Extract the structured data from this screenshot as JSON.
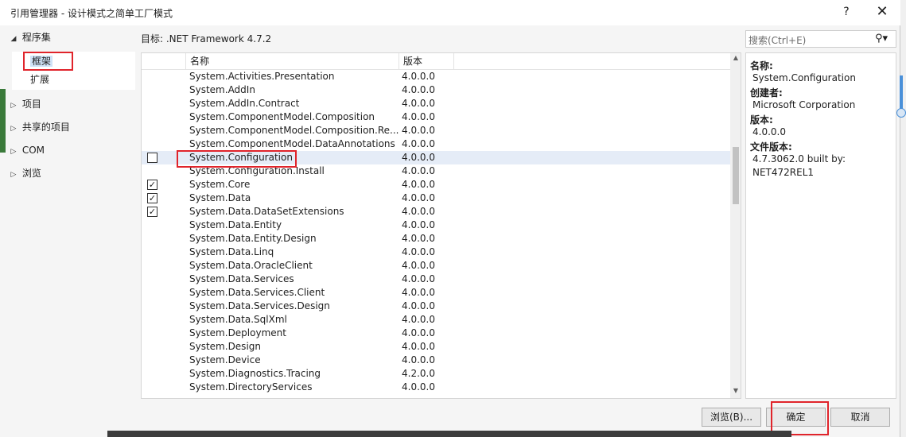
{
  "window": {
    "title": "引用管理器 - 设计模式之简单工厂模式",
    "help_label": "?",
    "close_label": "✕"
  },
  "nav": {
    "assemblies_label": "程序集",
    "framework_label": "框架",
    "extensions_label": "扩展",
    "projects_label": "项目",
    "shared_projects_label": "共享的项目",
    "com_label": "COM",
    "browse_label": "浏览"
  },
  "target_label": "目标: .NET Framework 4.7.2",
  "list": {
    "col_name": "名称",
    "col_version": "版本",
    "rows": [
      {
        "name": "System.Activities.Presentation",
        "version": "4.0.0.0",
        "checkbox": "none",
        "selected": false
      },
      {
        "name": "System.AddIn",
        "version": "4.0.0.0",
        "checkbox": "none",
        "selected": false
      },
      {
        "name": "System.AddIn.Contract",
        "version": "4.0.0.0",
        "checkbox": "none",
        "selected": false
      },
      {
        "name": "System.ComponentModel.Composition",
        "version": "4.0.0.0",
        "checkbox": "none",
        "selected": false
      },
      {
        "name": "System.ComponentModel.Composition.Re...",
        "version": "4.0.0.0",
        "checkbox": "none",
        "selected": false
      },
      {
        "name": "System.ComponentModel.DataAnnotations",
        "version": "4.0.0.0",
        "checkbox": "none",
        "selected": false
      },
      {
        "name": "System.Configuration",
        "version": "4.0.0.0",
        "checkbox": "unchecked",
        "selected": true
      },
      {
        "name": "System.Configuration.Install",
        "version": "4.0.0.0",
        "checkbox": "none",
        "selected": false
      },
      {
        "name": "System.Core",
        "version": "4.0.0.0",
        "checkbox": "checked",
        "selected": false
      },
      {
        "name": "System.Data",
        "version": "4.0.0.0",
        "checkbox": "checked",
        "selected": false
      },
      {
        "name": "System.Data.DataSetExtensions",
        "version": "4.0.0.0",
        "checkbox": "checked",
        "selected": false
      },
      {
        "name": "System.Data.Entity",
        "version": "4.0.0.0",
        "checkbox": "none",
        "selected": false
      },
      {
        "name": "System.Data.Entity.Design",
        "version": "4.0.0.0",
        "checkbox": "none",
        "selected": false
      },
      {
        "name": "System.Data.Linq",
        "version": "4.0.0.0",
        "checkbox": "none",
        "selected": false
      },
      {
        "name": "System.Data.OracleClient",
        "version": "4.0.0.0",
        "checkbox": "none",
        "selected": false
      },
      {
        "name": "System.Data.Services",
        "version": "4.0.0.0",
        "checkbox": "none",
        "selected": false
      },
      {
        "name": "System.Data.Services.Client",
        "version": "4.0.0.0",
        "checkbox": "none",
        "selected": false
      },
      {
        "name": "System.Data.Services.Design",
        "version": "4.0.0.0",
        "checkbox": "none",
        "selected": false
      },
      {
        "name": "System.Data.SqlXml",
        "version": "4.0.0.0",
        "checkbox": "none",
        "selected": false
      },
      {
        "name": "System.Deployment",
        "version": "4.0.0.0",
        "checkbox": "none",
        "selected": false
      },
      {
        "name": "System.Design",
        "version": "4.0.0.0",
        "checkbox": "none",
        "selected": false
      },
      {
        "name": "System.Device",
        "version": "4.0.0.0",
        "checkbox": "none",
        "selected": false
      },
      {
        "name": "System.Diagnostics.Tracing",
        "version": "4.2.0.0",
        "checkbox": "none",
        "selected": false
      },
      {
        "name": "System.DirectoryServices",
        "version": "4.0.0.0",
        "checkbox": "none",
        "selected": false
      }
    ]
  },
  "search": {
    "placeholder": "搜索(Ctrl+E)",
    "icon": "search-icon"
  },
  "details": {
    "name_key": "名称:",
    "name_value": "System.Configuration",
    "creator_key": "创建者:",
    "creator_value": "Microsoft Corporation",
    "version_key": "版本:",
    "version_value": "4.0.0.0",
    "file_version_key": "文件版本:",
    "file_version_value_1": "4.7.3062.0 built by:",
    "file_version_value_2": "NET472REL1"
  },
  "buttons": {
    "browse_label": "浏览(B)...",
    "ok_label": "确定",
    "cancel_label": "取消"
  },
  "colors": {
    "highlight_red": "#e0242b",
    "selected_row": "#e5ecf7"
  }
}
